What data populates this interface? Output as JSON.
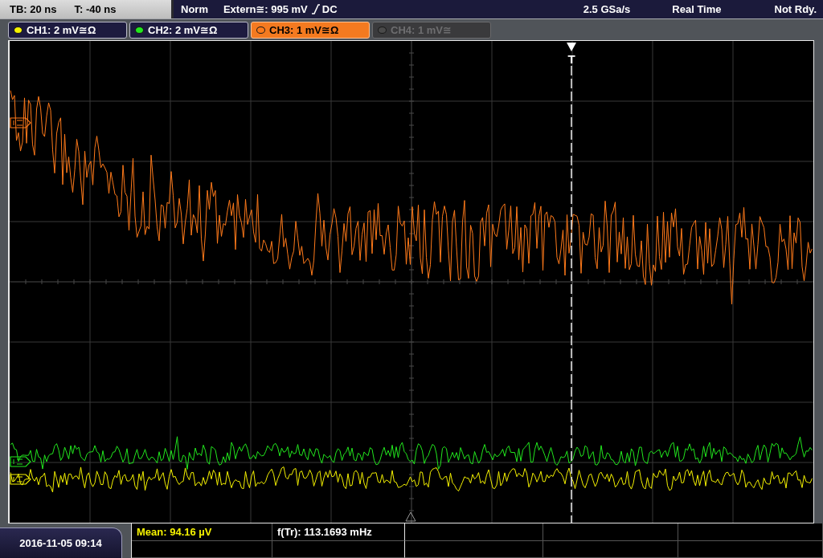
{
  "acquisition_bar": {
    "timebase": "TB: 20 ns",
    "trigger_offset": "T: -40 ns",
    "trigger_mode": "Norm",
    "trigger_source": "Extern≅: 995 mV",
    "trigger_coupling": "DC",
    "sample_rate": "2.5 GSa/s",
    "acquisition_mode": "Real Time",
    "run_status": "Not Rdy."
  },
  "channels": [
    {
      "label": "CH1: 2 mV≅Ω",
      "color": "#f5f200",
      "selected": false,
      "disabled": false
    },
    {
      "label": "CH2: 2 mV≅Ω",
      "color": "#22e81e",
      "selected": false,
      "disabled": false
    },
    {
      "label": "CH3: 1 mV≅Ω",
      "color": "#ff7a1a",
      "selected": true,
      "disabled": false
    },
    {
      "label": "CH4: 1 mV≅",
      "color": "#4a4a4a",
      "selected": false,
      "disabled": true
    }
  ],
  "display": {
    "trigger_marker": "T"
  },
  "measurements": [
    {
      "label": "Mean: 94.16 µV",
      "color": "#f5f200"
    },
    {
      "label": "f(Tr): 113.1693 mHz",
      "color": "#ffffff"
    }
  ],
  "datetime": "2016-11-05 09:14"
}
